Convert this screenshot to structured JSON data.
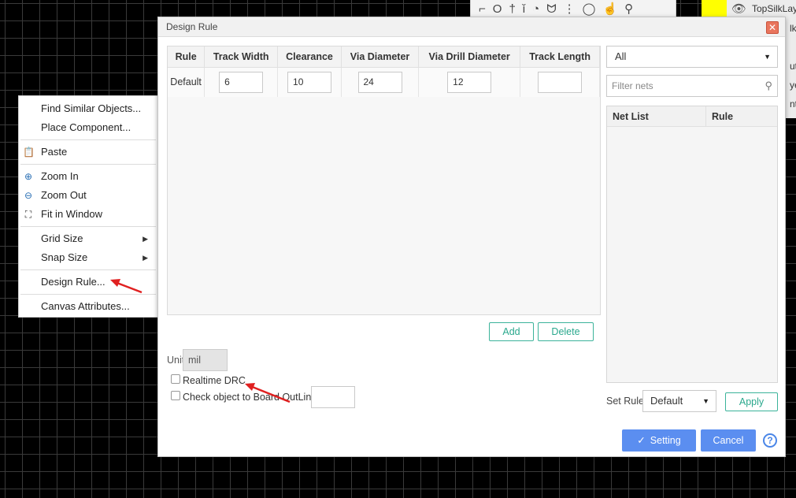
{
  "toolbar": {
    "icons": [
      "wire-tool-icon",
      "arc-tool-icon",
      "pin-tool-icon",
      "via-tool-icon",
      "sector-icon",
      "pad-icon",
      "hole-icon",
      "circle-icon",
      "hand-icon",
      "zoom-icon"
    ],
    "glyphs": [
      "⌐",
      "Ο",
      "†",
      "ǐ",
      "◔",
      "ᗢ",
      "⋮",
      "◯",
      "☝",
      "⚲"
    ]
  },
  "layers": {
    "top_name": "TopSilkLay",
    "fragments": [
      "lk",
      "utli",
      "ye",
      "nt"
    ],
    "top_color": "#ffff00"
  },
  "context_menu": {
    "items": [
      {
        "label": "Find Similar Objects...",
        "icon": ""
      },
      {
        "label": "Place Component...",
        "icon": ""
      },
      {
        "sep": true
      },
      {
        "label": "Paste",
        "icon": "paste-icon"
      },
      {
        "sep": true
      },
      {
        "label": "Zoom In",
        "icon": "zoom-in-icon"
      },
      {
        "label": "Zoom Out",
        "icon": "zoom-out-icon"
      },
      {
        "label": "Fit in Window",
        "icon": "fit-window-icon"
      },
      {
        "sep": true
      },
      {
        "label": "Grid Size",
        "submenu": true
      },
      {
        "label": "Snap Size",
        "submenu": true
      },
      {
        "sep": true
      },
      {
        "label": "Design Rule..."
      },
      {
        "sep": true
      },
      {
        "label": "Canvas Attributes..."
      }
    ]
  },
  "dialog": {
    "title": "Design Rule",
    "close_symbol": "✕",
    "table": {
      "headers": [
        "Rule",
        "Track Width",
        "Clearance",
        "Via Diameter",
        "Via Drill Diameter",
        "Track Length"
      ],
      "rows": [
        {
          "rule": "Default",
          "track_width": "6",
          "clearance": "10",
          "via_diameter": "24",
          "via_drill_diameter": "12",
          "track_length": ""
        }
      ]
    },
    "add_label": "Add",
    "delete_label": "Delete",
    "unit_label": "Unit",
    "unit_value": "mil",
    "realtime_drc_label": "Realtime DRC",
    "check_outline_label": "Check object to Board OutLine",
    "net_filter_selected": "All",
    "filter_placeholder": "Filter nets",
    "netlist_headers": [
      "Net List",
      "Rule"
    ],
    "set_rule_label": "Set Rule",
    "set_rule_value": "Default",
    "apply_label": "Apply",
    "setting_label": "Setting",
    "cancel_label": "Cancel",
    "help_symbol": "?"
  },
  "colors": {
    "accent_green": "#2aa88d",
    "primary_blue": "#5b8ef0",
    "close_red": "#e9755d",
    "annotation_arrow": "#e02020"
  }
}
